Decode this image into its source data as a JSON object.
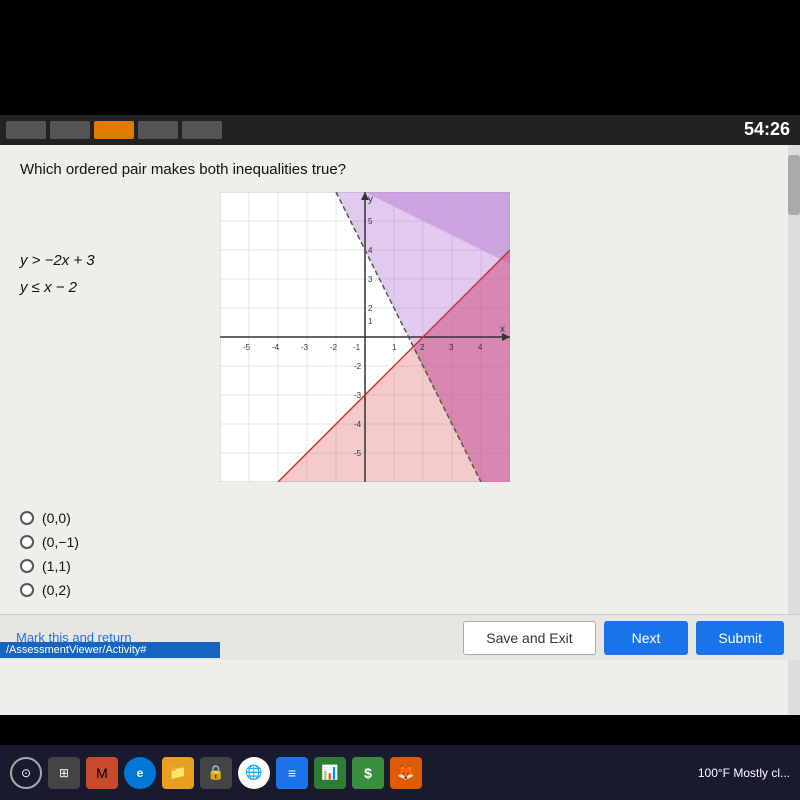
{
  "timer": {
    "value": "54:26"
  },
  "question": {
    "text": "Which ordered pair makes both inequalities true?"
  },
  "equations": [
    {
      "label": "y > −2x + 3"
    },
    {
      "label": "y ≤ x − 2"
    }
  ],
  "answer_options": [
    {
      "value": "(0,0)",
      "selected": false
    },
    {
      "value": "(0,−1)",
      "selected": false
    },
    {
      "value": "(1,1)",
      "selected": false
    },
    {
      "value": "(0,2)",
      "selected": false
    }
  ],
  "buttons": {
    "mark": "Mark this and return",
    "save": "Save and Exit",
    "next": "Next",
    "submit": "Submit"
  },
  "url": "/AssessmentViewer/Activity#",
  "weather": "100°F  Mostly cl...",
  "graph": {
    "x_min": -5,
    "x_max": 5,
    "y_min": -5,
    "y_max": 5,
    "purple_region_label": "y > -2x+3",
    "red_region_label": "y <= x-2"
  }
}
